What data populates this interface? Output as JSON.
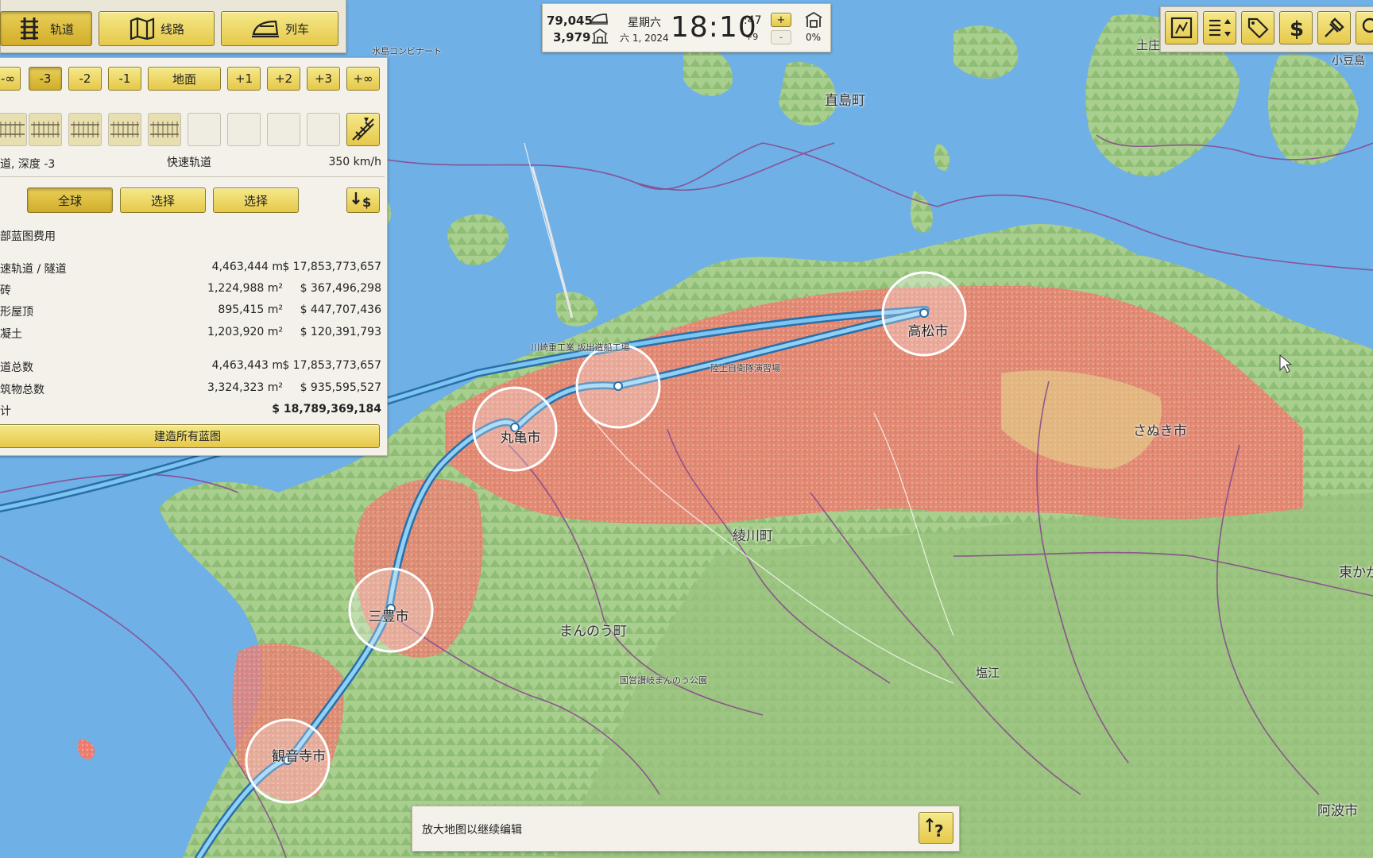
{
  "top_tabs": [
    {
      "label": "轨道",
      "icon": "track-icon"
    },
    {
      "label": "线路",
      "icon": "line-icon"
    },
    {
      "label": "列车",
      "icon": "train-icon"
    }
  ],
  "depth_buttons": [
    "-∞",
    "-3",
    "-2",
    "-1",
    "地面",
    "+1",
    "+2",
    "+3",
    "+∞"
  ],
  "track_info": {
    "left": "道, 深度 -3",
    "center": "快速轨道",
    "right": "350 km/h"
  },
  "scope_tabs": [
    "全球",
    "选择",
    "选择"
  ],
  "cost": {
    "header": "部蓝图费用",
    "rows": [
      {
        "name": "速轨道 / 隧道",
        "qty": "4,463,444 m",
        "cost": "$ 17,853,773,657"
      },
      {
        "name": "砖",
        "qty": "1,224,988 m²",
        "cost": "$ 367,496,298"
      },
      {
        "name": "形屋顶",
        "qty": "895,415 m²",
        "cost": "$ 447,707,436"
      },
      {
        "name": "凝土",
        "qty": "1,203,920 m²",
        "cost": "$ 120,391,793"
      }
    ],
    "totals": [
      {
        "name": "道总数",
        "qty": "4,463,443 m",
        "cost": "$ 17,853,773,657"
      },
      {
        "name": "筑物总数",
        "qty": "3,324,323 m²",
        "cost": "$ 935,595,527"
      }
    ],
    "total_label": "计",
    "total_value": "$ 18,789,369,184",
    "build_button": "建造所有蓝图"
  },
  "status": {
    "trains": "79,045",
    "passengers": "3,979",
    "weekday": "星期六",
    "date": "六 1, 2024",
    "time": "18:10",
    "seconds": ":47",
    "tz": "+9",
    "pct": "0%",
    "plus": "+",
    "minus": "-"
  },
  "hint": {
    "text": "放大地图以继续编辑"
  },
  "map_labels": {
    "naoshima": "直島町",
    "ayagawa": "綾川町",
    "manno": "まんのう町",
    "sanuki": "さぬき市",
    "shioe": "塩江",
    "higashikagawa": "東かが",
    "awa": "阿波市",
    "tonosho": "土庄",
    "shodoshima": "小豆島",
    "mizushima": "水島コンビナート",
    "kawasaki": "川崎重工業 坂出造船工場",
    "jieitai": "陸上自衛隊演習場",
    "park": "国営讃岐まんのう公園"
  },
  "cities": {
    "takamatsu": "高松市",
    "marugame": "丸亀市",
    "mitoyo": "三豊市",
    "kanonji": "観音寺市"
  },
  "right_tools": [
    "map-mode-icon",
    "sort-icon",
    "tag-icon",
    "dollar-icon",
    "build-icon",
    "search-icon"
  ]
}
